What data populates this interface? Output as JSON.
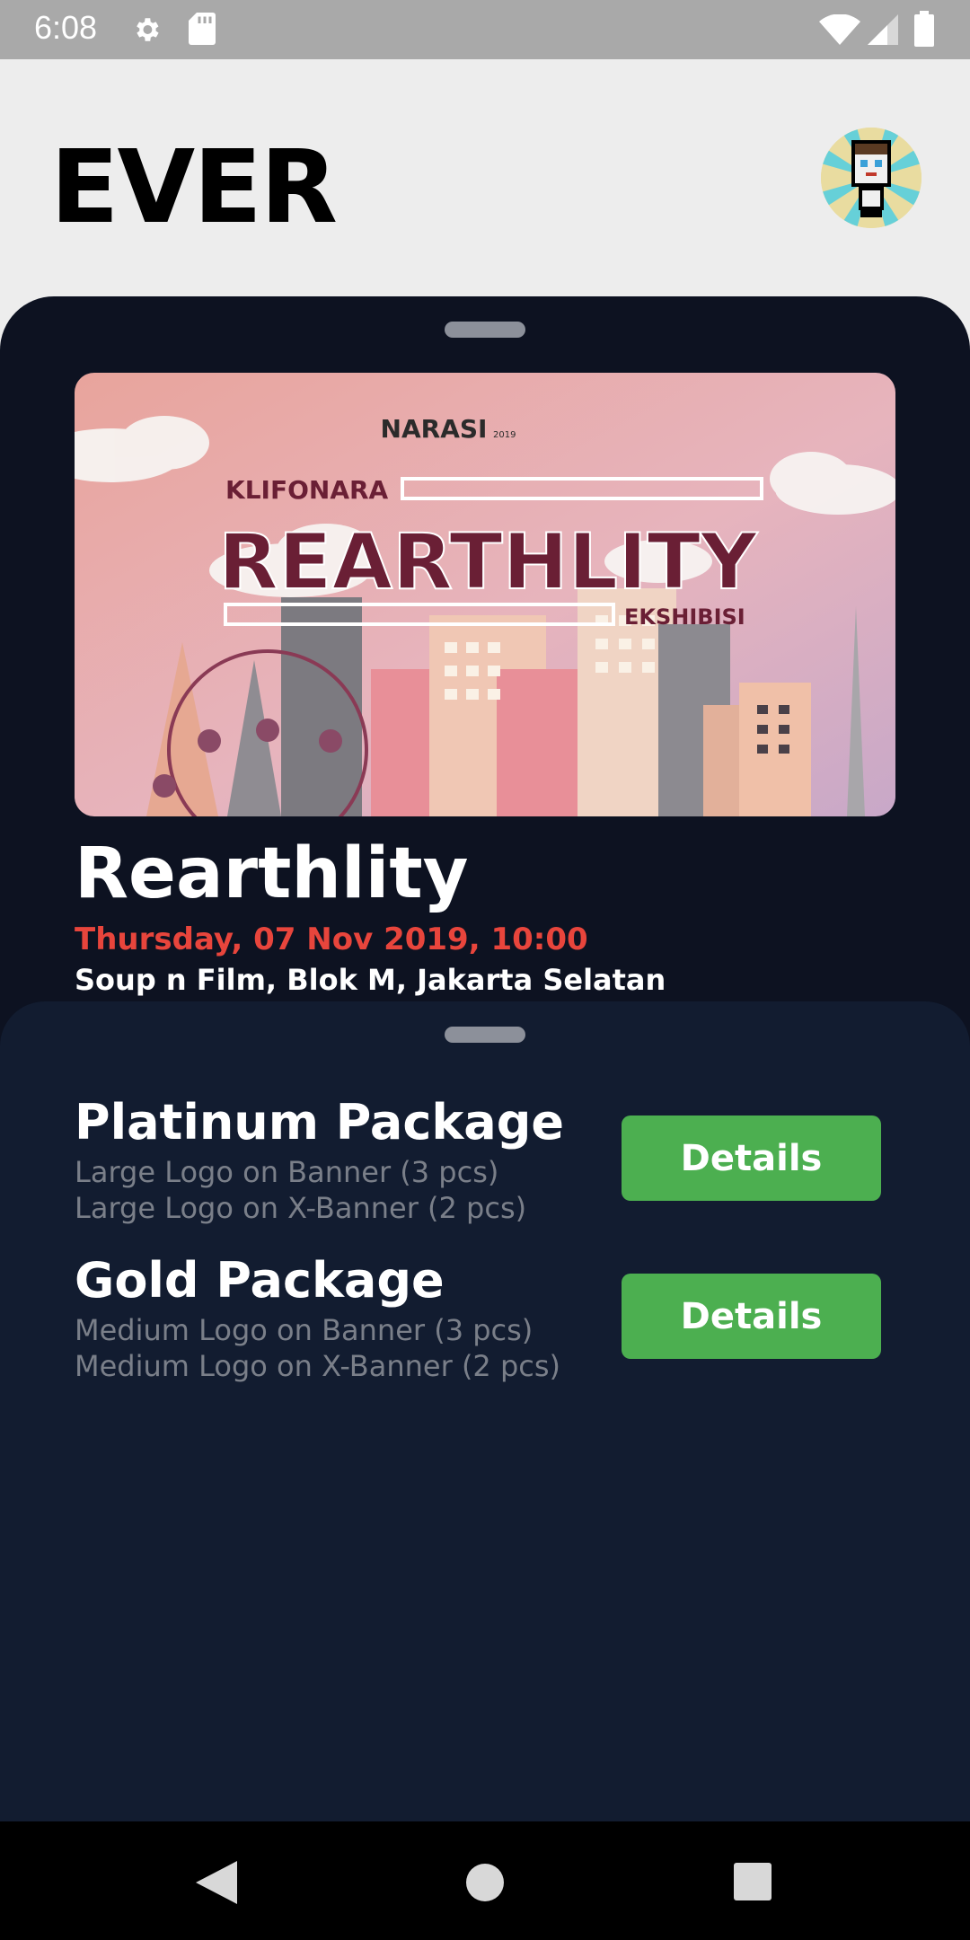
{
  "status_bar": {
    "time": "6:08"
  },
  "app": {
    "title": "EVER"
  },
  "event": {
    "banner": {
      "brand": "NARASI",
      "brand_sub": "2019",
      "pre_title": "KLIFONARA",
      "headline": "REARTHLITY",
      "post_title": "EKSHIBISI"
    },
    "title": "Rearthlity",
    "date": "Thursday, 07 Nov 2019, 10:00",
    "venue": "Soup n Film, Blok M, Jakarta Selatan"
  },
  "packages": [
    {
      "name": "Platinum Package",
      "items": [
        "Large Logo on Banner (3 pcs)",
        "Large Logo on X-Banner (2 pcs)"
      ],
      "button": "Details"
    },
    {
      "name": "Gold Package",
      "items": [
        "Medium Logo on Banner (3 pcs)",
        "Medium Logo on X-Banner (2 pcs)"
      ],
      "button": "Details"
    }
  ],
  "colors": {
    "accent_green": "#4caf50",
    "date_red": "#e8453c",
    "sheet_dark": "#0d1221",
    "sheet_navy": "#121c30"
  }
}
